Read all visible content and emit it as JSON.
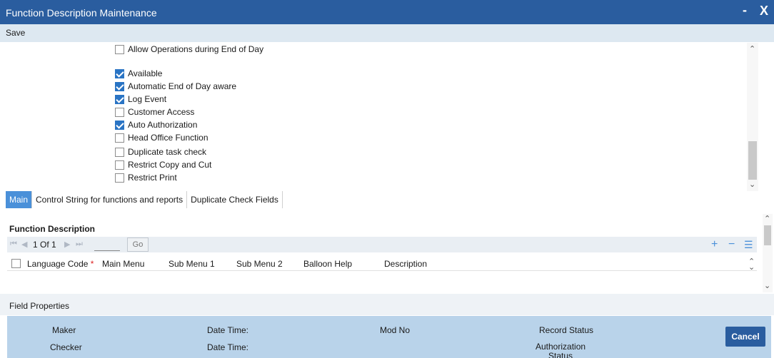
{
  "window": {
    "title": "Function Description Maintenance",
    "minimize_glyph": "-",
    "close_glyph": "X"
  },
  "toolbar": {
    "save_label": "Save"
  },
  "options": [
    {
      "label": "Allow Operations during End of Day",
      "checked": false
    },
    {
      "label": "Available",
      "checked": true
    },
    {
      "label": "Automatic End of Day aware",
      "checked": true
    },
    {
      "label": "Log Event",
      "checked": true
    },
    {
      "label": "Customer Access",
      "checked": false
    },
    {
      "label": "Auto Authorization",
      "checked": true
    },
    {
      "label": "Head Office Function",
      "checked": false
    },
    {
      "label": "Duplicate task check",
      "checked": false
    },
    {
      "label": "Restrict Copy and Cut",
      "checked": false
    },
    {
      "label": "Restrict Print",
      "checked": false
    }
  ],
  "tabs": [
    {
      "label": "Main",
      "active": true
    },
    {
      "label": "Control String for functions and reports",
      "active": false
    },
    {
      "label": "Duplicate Check Fields",
      "active": false
    }
  ],
  "function_description": {
    "title": "Function Description",
    "pager_text": "1 Of 1",
    "go_label": "Go",
    "columns": {
      "language_code": "Language Code",
      "required_mark": "*",
      "main_menu": "Main Menu",
      "sub_menu_1": "Sub Menu 1",
      "sub_menu_2": "Sub Menu 2",
      "balloon_help": "Balloon Help",
      "description": "Description"
    }
  },
  "field_properties": {
    "label": "Field Properties"
  },
  "audit": {
    "maker": "Maker",
    "checker": "Checker",
    "date_time_1": "Date Time:",
    "date_time_2": "Date Time:",
    "mod_no": "Mod No",
    "record_status": "Record Status",
    "authorization_status": "Authorization Status"
  },
  "cancel_label": "Cancel",
  "colors": {
    "title_bar": "#2a5d9f",
    "active_tab": "#4a90d9",
    "audit_bg": "#b9d3ea",
    "checkbox_checked": "#2a74c4"
  }
}
